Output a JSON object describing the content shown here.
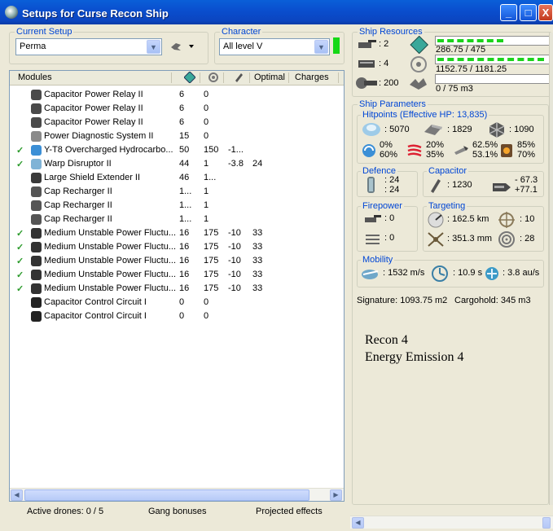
{
  "window": {
    "title": "Setups for Curse Recon Ship",
    "buttons": {
      "minimize": "_",
      "maximize": "□",
      "close": "X"
    }
  },
  "setup": {
    "current_setup_label": "Current Setup",
    "current_setup_value": "Perma",
    "character_label": "Character",
    "character_value": "All level V"
  },
  "modules": {
    "headers": {
      "name": "Modules",
      "optimal": "Optimal",
      "charges": "Charges"
    },
    "rows": [
      {
        "checked": "",
        "name": "Capacitor Power Relay II",
        "c1": "6",
        "c2": "0",
        "c3": "",
        "c4": "",
        "icon": "capacitor-relay-icon"
      },
      {
        "checked": "",
        "name": "Capacitor Power Relay II",
        "c1": "6",
        "c2": "0",
        "c3": "",
        "c4": "",
        "icon": "capacitor-relay-icon"
      },
      {
        "checked": "",
        "name": "Capacitor Power Relay II",
        "c1": "6",
        "c2": "0",
        "c3": "",
        "c4": "",
        "icon": "capacitor-relay-icon"
      },
      {
        "checked": "",
        "name": "Power Diagnostic System II",
        "c1": "15",
        "c2": "0",
        "c3": "",
        "c4": "",
        "icon": "power-diagnostic-icon"
      },
      {
        "checked": "✓",
        "name": "Y-T8 Overcharged Hydrocarbo...",
        "c1": "50",
        "c2": "150",
        "c3": "-1...",
        "c4": "",
        "icon": "afterburner-icon"
      },
      {
        "checked": "✓",
        "name": "Warp Disruptor II",
        "c1": "44",
        "c2": "1",
        "c3": "-3.8",
        "c4": "24",
        "icon": "warp-disruptor-icon"
      },
      {
        "checked": "",
        "name": "Large Shield Extender II",
        "c1": "46",
        "c2": "1...",
        "c3": "",
        "c4": "",
        "icon": "shield-extender-icon"
      },
      {
        "checked": "",
        "name": "Cap Recharger II",
        "c1": "1...",
        "c2": "1",
        "c3": "",
        "c4": "",
        "icon": "cap-recharger-icon"
      },
      {
        "checked": "",
        "name": "Cap Recharger II",
        "c1": "1...",
        "c2": "1",
        "c3": "",
        "c4": "",
        "icon": "cap-recharger-icon"
      },
      {
        "checked": "",
        "name": "Cap Recharger II",
        "c1": "1...",
        "c2": "1",
        "c3": "",
        "c4": "",
        "icon": "cap-recharger-icon"
      },
      {
        "checked": "✓",
        "name": "Medium Unstable Power Fluctu...",
        "c1": "16",
        "c2": "175",
        "c3": "-10",
        "c4": "33",
        "icon": "energy-neutralizer-icon"
      },
      {
        "checked": "✓",
        "name": "Medium Unstable Power Fluctu...",
        "c1": "16",
        "c2": "175",
        "c3": "-10",
        "c4": "33",
        "icon": "energy-neutralizer-icon"
      },
      {
        "checked": "✓",
        "name": "Medium Unstable Power Fluctu...",
        "c1": "16",
        "c2": "175",
        "c3": "-10",
        "c4": "33",
        "icon": "energy-neutralizer-icon"
      },
      {
        "checked": "✓",
        "name": "Medium Unstable Power Fluctu...",
        "c1": "16",
        "c2": "175",
        "c3": "-10",
        "c4": "33",
        "icon": "energy-neutralizer-icon"
      },
      {
        "checked": "✓",
        "name": "Medium Unstable Power Fluctu...",
        "c1": "16",
        "c2": "175",
        "c3": "-10",
        "c4": "33",
        "icon": "energy-neutralizer-icon"
      },
      {
        "checked": "",
        "name": "Capacitor Control Circuit I",
        "c1": "0",
        "c2": "0",
        "c3": "",
        "c4": "",
        "icon": "rig-icon"
      },
      {
        "checked": "",
        "name": "Capacitor Control Circuit I",
        "c1": "0",
        "c2": "0",
        "c3": "",
        "c4": "",
        "icon": "rig-icon"
      }
    ]
  },
  "status": {
    "drones": "Active drones: 0 / 5",
    "gang": "Gang bonuses",
    "projected": "Projected effects"
  },
  "resources": {
    "label": "Ship Resources",
    "turrets": ": 2",
    "launchers": ": 4",
    "calibration": ": 200",
    "cpu": "286.75 / 475",
    "cpu_fraction": 0.604,
    "powergrid": "1152.75 / 1181.25",
    "powergrid_fraction": 0.976,
    "drone_bay": "0 / 75 m3",
    "drone_bay_fraction": 0
  },
  "parameters": {
    "label": "Ship Parameters",
    "hitpoints_label": "Hitpoints (Effective HP: 13,835)",
    "shield_hp": ": 5070",
    "armor_hp": ": 1829",
    "structure_hp": ": 1090",
    "res_em": [
      "0%",
      "60%"
    ],
    "res_thermal": [
      "20%",
      "35%"
    ],
    "res_kinetic": [
      "62.5%",
      "53.1%"
    ],
    "res_explosive": [
      "85%",
      "70%"
    ],
    "defence_label": "Defence",
    "defence_values": [
      ": 24",
      ": 24"
    ],
    "capacitor_label": "Capacitor",
    "capacitor_amount": ": 1230",
    "capacitor_delta": [
      "- 67.3",
      "+77.1"
    ],
    "firepower_label": "Firepower",
    "firepower_values": [
      ": 0",
      ": 0"
    ],
    "targeting_label": "Targeting",
    "target_range": ": 162.5 km",
    "max_targets": ": 10",
    "scan_res": ": 351.3 mm",
    "sensor_strength": ": 28",
    "mobility_label": "Mobility",
    "velocity": ": 1532 m/s",
    "align_time": ": 10.9 s",
    "warp_speed": ": 3.8 au/s",
    "signature": "Signature: 1093.75 m2",
    "cargohold": "Cargohold: 345 m3"
  },
  "notes": [
    "Recon 4",
    "Energy Emission 4"
  ],
  "colors": {
    "accent": "#0046d5",
    "titlebar": "#0a4fcf",
    "bar_fill": "#1bd31b",
    "check": "#2b9a2b"
  }
}
